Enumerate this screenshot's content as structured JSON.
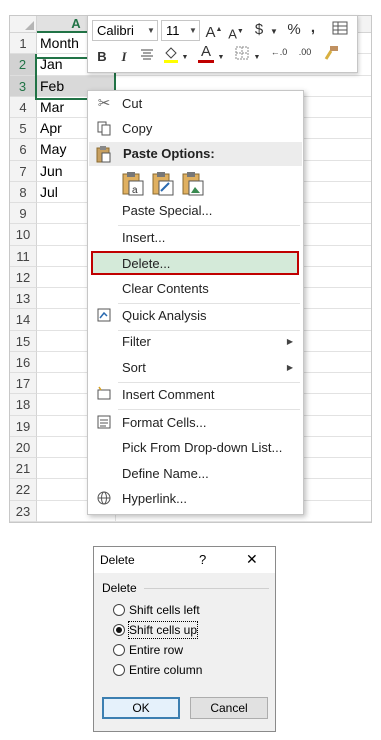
{
  "spreadsheet": {
    "column_header": "A",
    "rows": [
      {
        "num": "1",
        "value": "Month"
      },
      {
        "num": "2",
        "value": "Jan"
      },
      {
        "num": "3",
        "value": "Feb"
      },
      {
        "num": "4",
        "value": "Mar"
      },
      {
        "num": "5",
        "value": "Apr"
      },
      {
        "num": "6",
        "value": "May"
      },
      {
        "num": "7",
        "value": "Jun"
      },
      {
        "num": "8",
        "value": "Jul"
      },
      {
        "num": "9",
        "value": ""
      },
      {
        "num": "10",
        "value": ""
      },
      {
        "num": "11",
        "value": ""
      },
      {
        "num": "12",
        "value": ""
      },
      {
        "num": "13",
        "value": ""
      },
      {
        "num": "14",
        "value": ""
      },
      {
        "num": "15",
        "value": ""
      },
      {
        "num": "16",
        "value": ""
      },
      {
        "num": "17",
        "value": ""
      },
      {
        "num": "18",
        "value": ""
      },
      {
        "num": "19",
        "value": ""
      },
      {
        "num": "20",
        "value": ""
      },
      {
        "num": "21",
        "value": ""
      },
      {
        "num": "22",
        "value": ""
      },
      {
        "num": "23",
        "value": ""
      }
    ],
    "selected_rows": [
      "2",
      "3"
    ],
    "accent_color": "#217346"
  },
  "mini_toolbar": {
    "font_name": "Calibri",
    "font_size": "11",
    "grow_font": "A",
    "shrink_font": "A",
    "currency": "$",
    "percent": "%",
    "comma": ",",
    "bold": "B",
    "italic": "I",
    "font_color_letter": "A",
    "font_color": "#c00000",
    "increase_decimal": "←.0",
    "decrease_decimal": ".00",
    "icons": [
      "increase-font-icon",
      "decrease-font-icon",
      "currency-icon",
      "percent-icon",
      "comma-style-icon",
      "format-table-icon",
      "align-icon",
      "fill-color-icon",
      "font-color-icon",
      "borders-icon",
      "format-painter-icon"
    ]
  },
  "context_menu": {
    "cut": "Cut",
    "copy": "Copy",
    "paste_options": "Paste Options:",
    "paste_special": "Paste Special...",
    "insert": "Insert...",
    "delete": "Delete...",
    "clear_contents": "Clear Contents",
    "quick_analysis": "Quick Analysis",
    "filter": "Filter",
    "sort": "Sort",
    "insert_comment": "Insert Comment",
    "format_cells": "Format Cells...",
    "pick_dropdown": "Pick From Drop-down List...",
    "define_name": "Define Name...",
    "hyperlink": "Hyperlink...",
    "highlighted_item": "Delete...",
    "highlight_border_color": "#c00000"
  },
  "delete_dialog": {
    "title": "Delete",
    "help": "?",
    "close": "✕",
    "group_label": "Delete",
    "options": [
      "Shift cells left",
      "Shift cells up",
      "Entire row",
      "Entire column"
    ],
    "selected_option": "Shift cells up",
    "ok_label": "OK",
    "cancel_label": "Cancel"
  }
}
